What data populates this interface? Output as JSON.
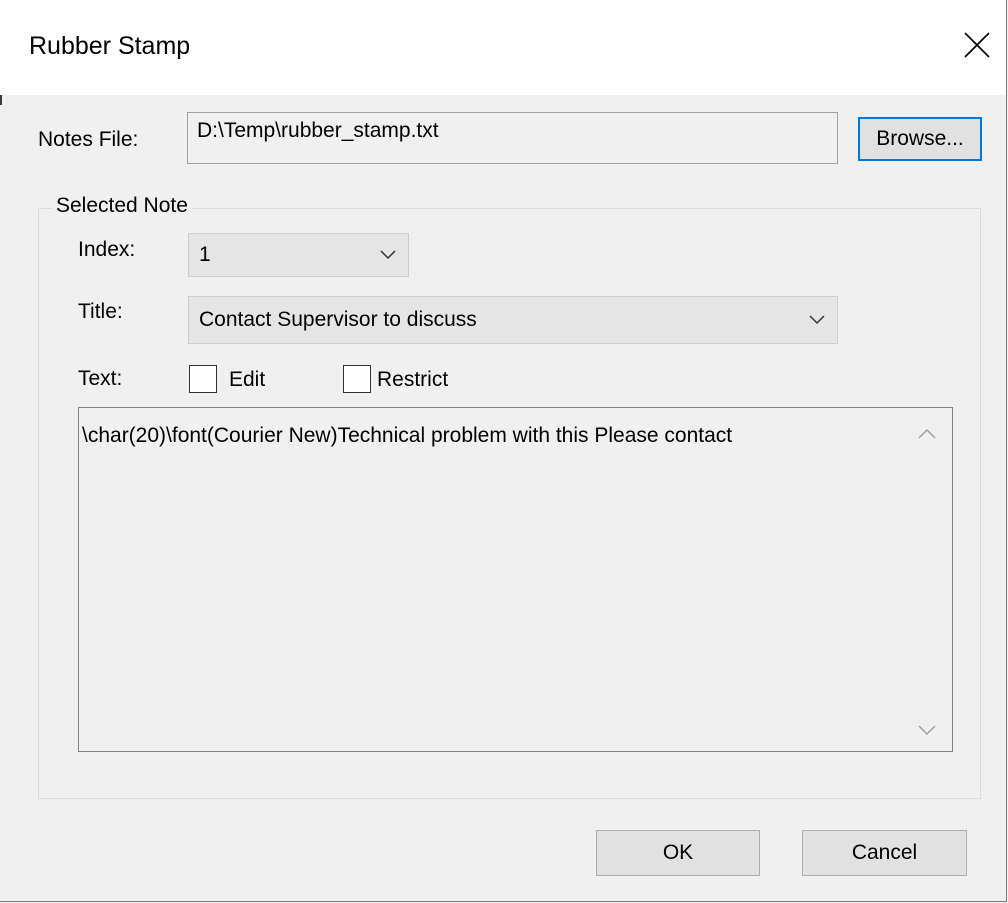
{
  "dialog": {
    "title": "Rubber Stamp"
  },
  "notes_file": {
    "label": "Notes File:",
    "value": "D:\\Temp\\rubber_stamp.txt",
    "browse_label": "Browse..."
  },
  "selected_note": {
    "group_label": "Selected Note",
    "index_label": "Index:",
    "index_value": "1",
    "title_label": "Title:",
    "title_value": "Contact Supervisor to discuss",
    "text_label": "Text:",
    "edit_label": "Edit",
    "edit_checked": false,
    "restrict_label": "Restrict",
    "restrict_checked": false,
    "text_value": "\\char(20)\\font(Courier New)Technical problem with this Please contact"
  },
  "buttons": {
    "ok_label": "OK",
    "cancel_label": "Cancel"
  },
  "icons": {
    "close": "close-icon",
    "dropdown": "chevron-down-icon",
    "scroll_up": "scroll-up-icon",
    "scroll_down": "scroll-down-icon"
  },
  "colors": {
    "accent": "#0078d7",
    "background": "#f0f0f0",
    "titlebar": "#ffffff"
  }
}
